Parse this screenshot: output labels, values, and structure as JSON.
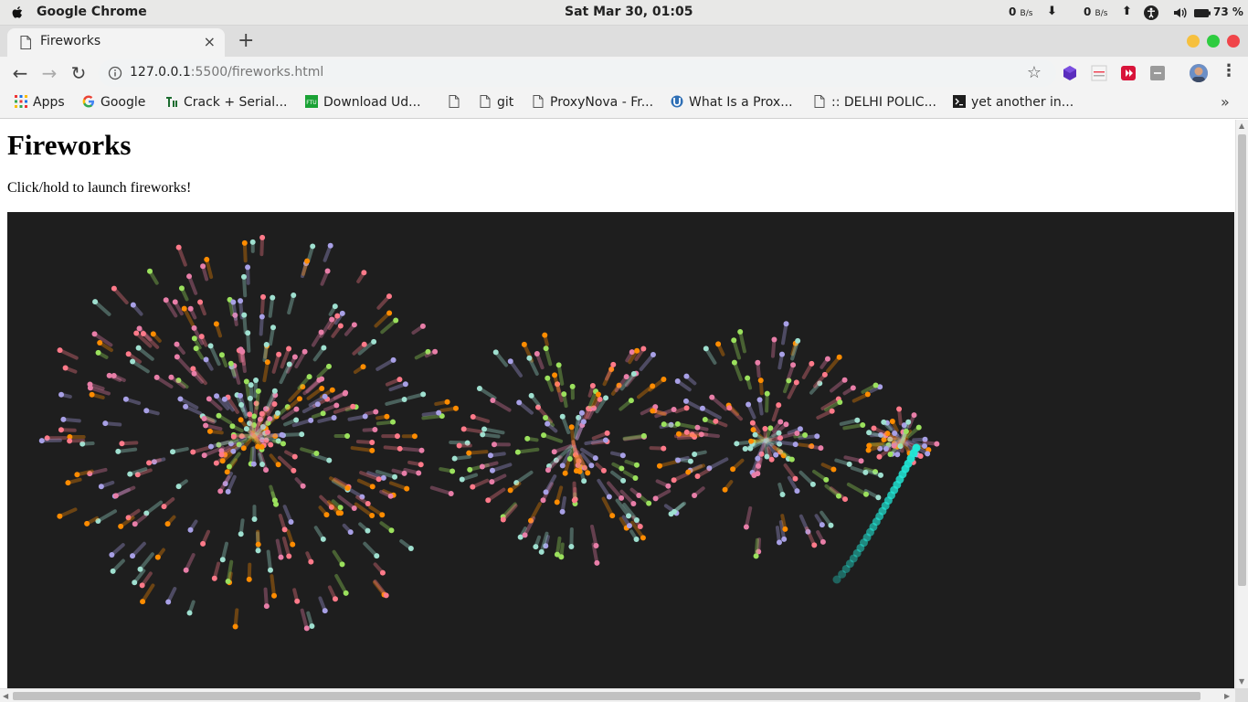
{
  "os": {
    "app_name": "Google Chrome",
    "clock": "Sat Mar 30, 01:05",
    "net_down_value": "0",
    "net_down_unit": "B/s",
    "net_up_value": "0",
    "net_up_unit": "B/s",
    "down_arrow": "⬇",
    "up_arrow": "⬆",
    "battery": "73 %"
  },
  "tabs": [
    {
      "title": "Fireworks",
      "close": "×"
    }
  ],
  "newtab": "+",
  "toolbar": {
    "back": "←",
    "forward": "→",
    "reload": "↻",
    "url_host": "127.0.0.1",
    "url_rest": ":5500/fireworks.html",
    "star": "☆",
    "menu": "⋮"
  },
  "bookmarks": [
    {
      "label": "Apps",
      "icon": "apps-grid-icon"
    },
    {
      "label": "Google",
      "icon": "google-icon"
    },
    {
      "label": "Crack + Serial...",
      "icon": "site-icon"
    },
    {
      "label": "Download Ud...",
      "icon": "ftu-icon"
    },
    {
      "label": "",
      "icon": "page-icon"
    },
    {
      "label": "git",
      "icon": "page-icon"
    },
    {
      "label": "ProxyNova - Fr...",
      "icon": "page-icon"
    },
    {
      "label": "What Is a Prox...",
      "icon": "site-icon"
    },
    {
      "label": ":: DELHI POLIC...",
      "icon": "page-icon"
    },
    {
      "label": "yet another in...",
      "icon": "terminal-icon"
    }
  ],
  "bookmarks_more": "»",
  "page": {
    "heading": "Fireworks",
    "instruction": "Click/hold to launch fireworks!"
  },
  "colors": {
    "canvas_bg": "#1e1e1e",
    "particles": [
      "#ff7a8a",
      "#9be15d",
      "#ff8c00",
      "#a8a0e6",
      "#9fe0d0",
      "#e87ea8"
    ],
    "rocket_trail": "#21e6d6",
    "win_min": "#f6c03e",
    "win_max": "#2ecc40",
    "win_close": "#f0454a"
  }
}
